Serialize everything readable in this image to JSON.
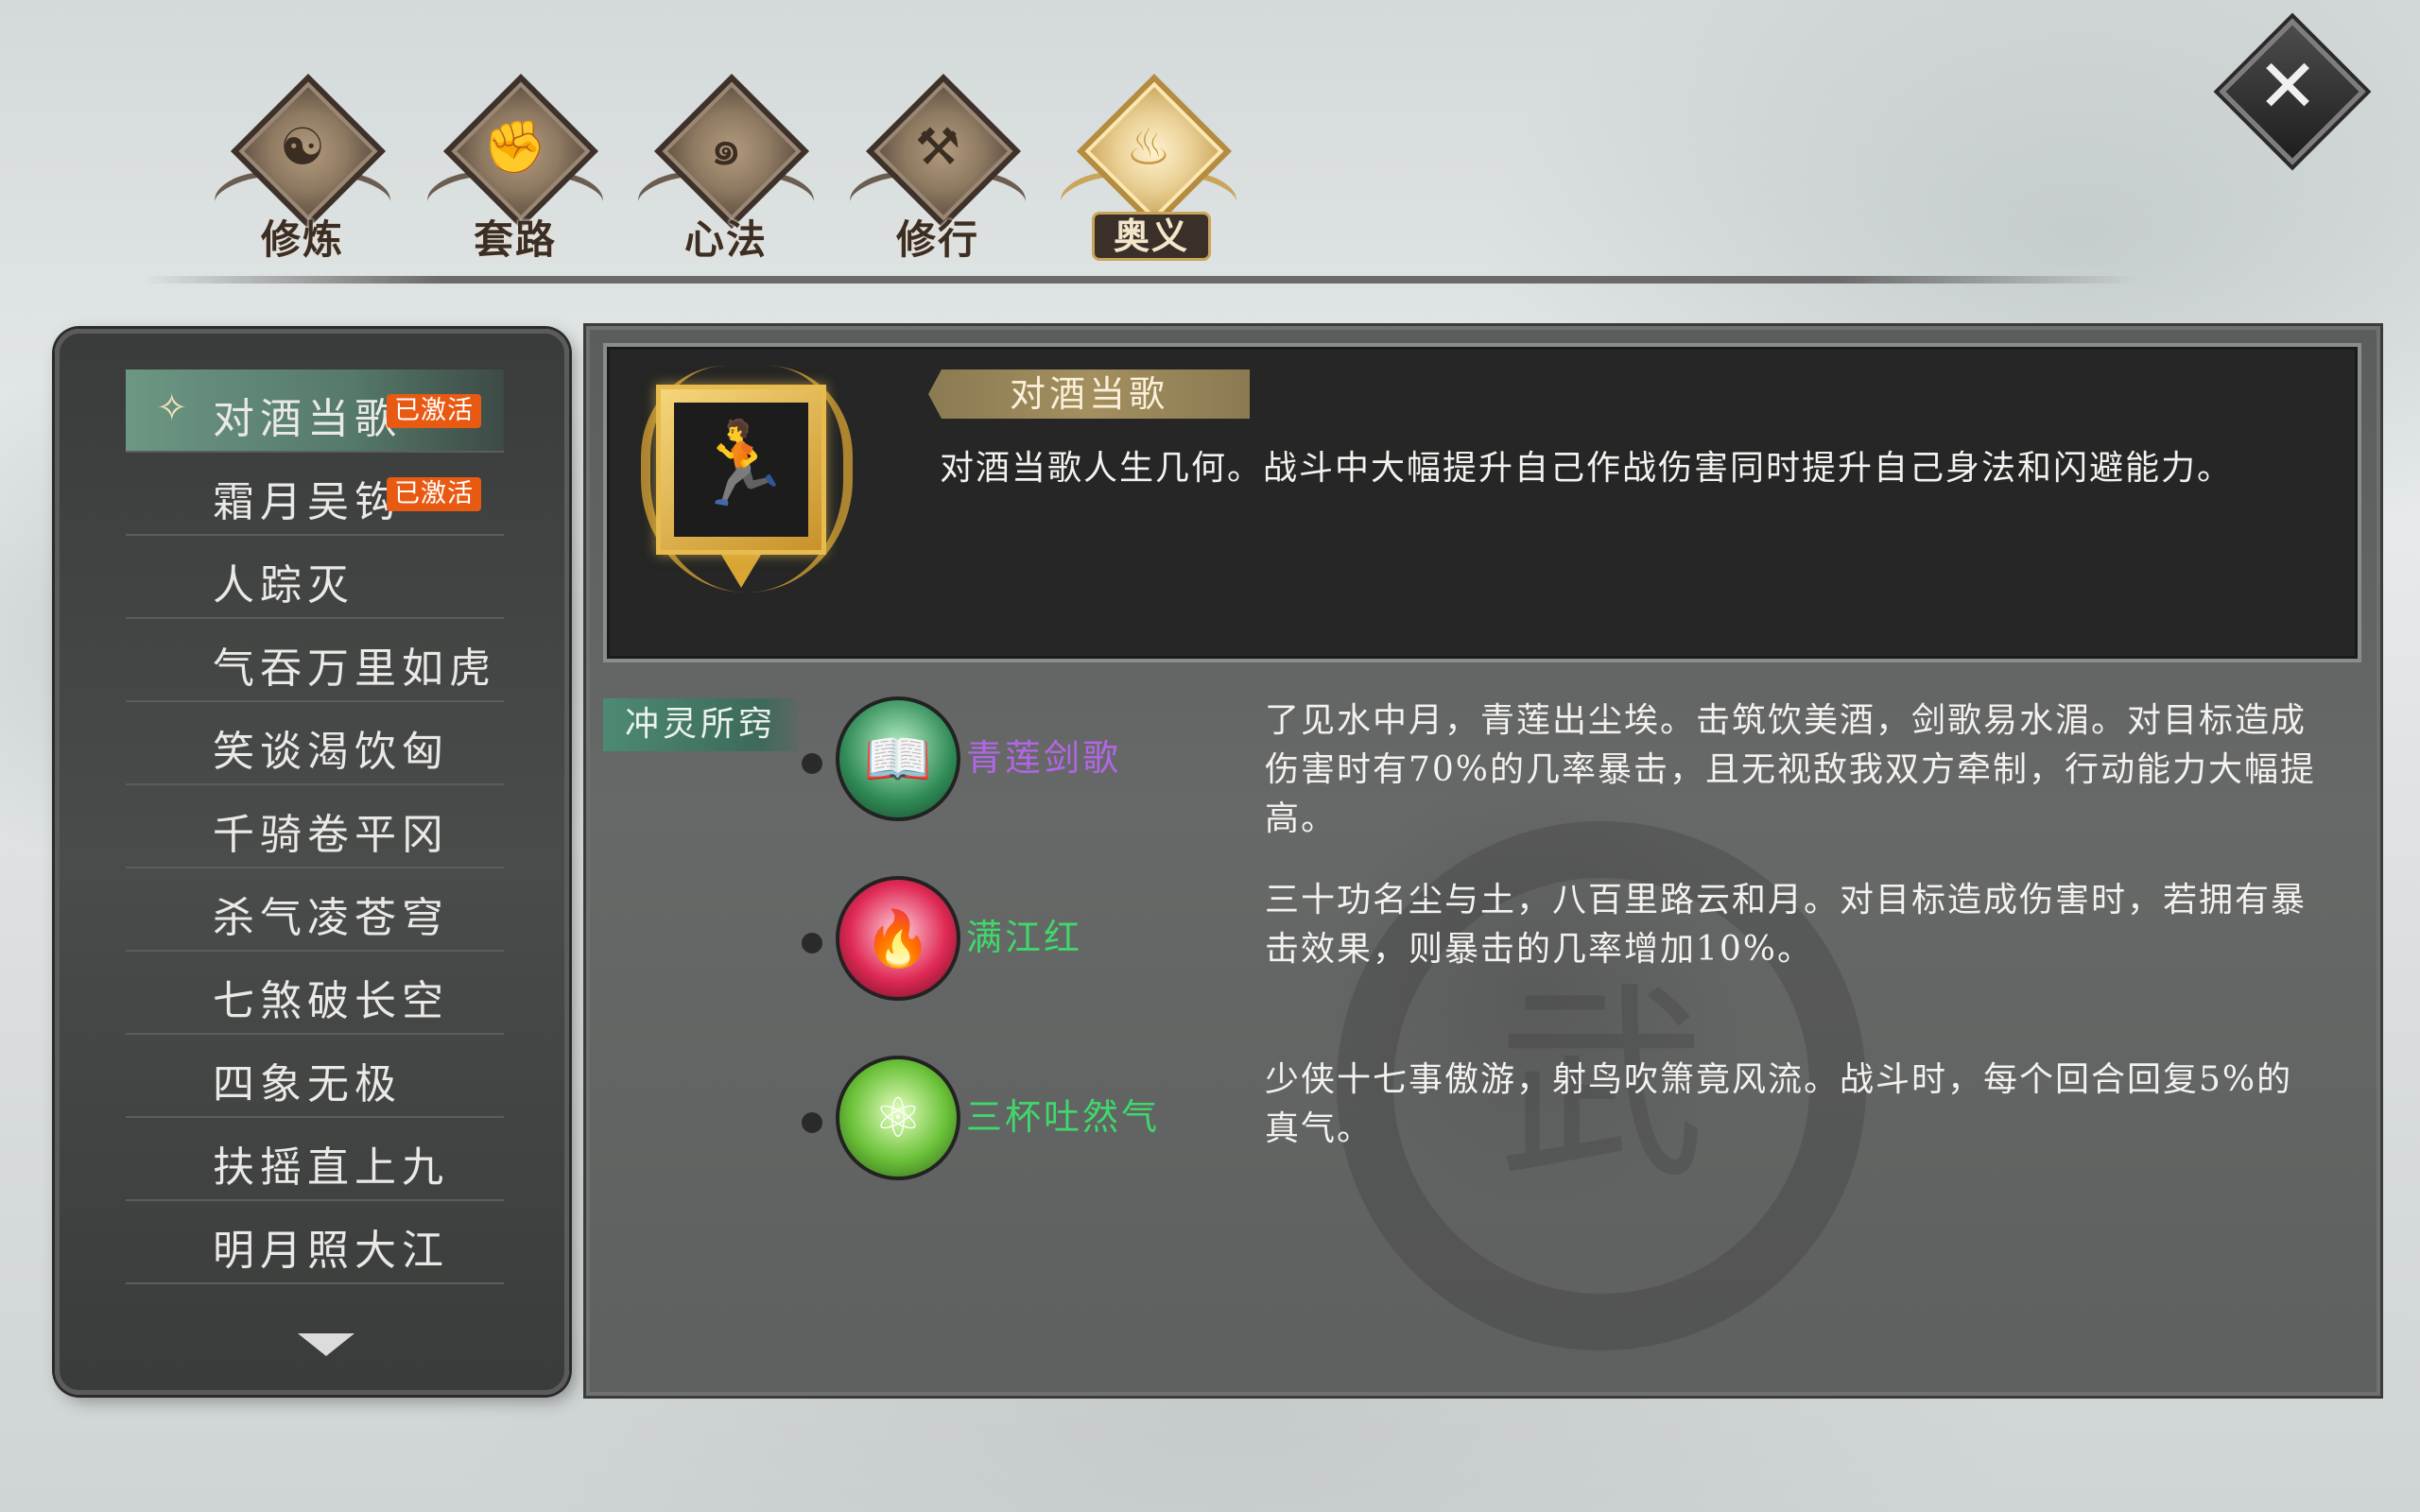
{
  "tabs": [
    {
      "label": "修炼",
      "icon": "yin-yang-icon",
      "glyph": "☯"
    },
    {
      "label": "套路",
      "icon": "fist-icon",
      "glyph": "✊"
    },
    {
      "label": "心法",
      "icon": "swirl-icon",
      "glyph": "๑"
    },
    {
      "label": "修行",
      "icon": "scroll-icon",
      "glyph": "⚒"
    },
    {
      "label": "奥义",
      "icon": "flame-icon",
      "glyph": "♨"
    }
  ],
  "active_tab": "奥义",
  "close": {
    "glyph": "✕"
  },
  "skill_list": [
    {
      "name": "对酒当歌",
      "badge": "已激活",
      "selected": true
    },
    {
      "name": "霜月吴钩",
      "badge": "已激活"
    },
    {
      "name": "人踪灭"
    },
    {
      "name": "气吞万里如虎"
    },
    {
      "name": "笑谈渴饮匈"
    },
    {
      "name": "千骑卷平冈"
    },
    {
      "name": "杀气凌苍穹"
    },
    {
      "name": "七煞破长空"
    },
    {
      "name": "四象无极"
    },
    {
      "name": "扶摇直上九"
    },
    {
      "name": "明月照大江"
    }
  ],
  "selected_arrow": "✧",
  "detail": {
    "title": "对酒当歌",
    "icon_glyph": "🏃",
    "description": "对酒当歌人生几何。战斗中大幅提升自己作战伤害同时提升自己身法和闪避能力。",
    "emblem_glyph": "武"
  },
  "section_tag": "冲灵所窍",
  "sub_skills": [
    {
      "name": "青莲剑歌",
      "icon": "lotus-book-icon",
      "glyph": "📖",
      "name_color": "#b266e6",
      "description": "了见水中月，青莲出尘埃。击筑饮美酒，剑歌易水湄。对目标造成伤害时有70%的几率暴击，且无视敌我双方牵制，行动能力大幅提高。"
    },
    {
      "name": "满江红",
      "icon": "red-flame-icon",
      "glyph": "🔥",
      "name_color": "#3fd86b",
      "description": "三十功名尘与土，八百里路云和月。对目标造成伤害时，若拥有暴击效果，则暴击的几率增加10%。"
    },
    {
      "name": "三杯吐然气",
      "icon": "green-rune-icon",
      "glyph": "⚛",
      "name_color": "#3fd86b",
      "description": "少侠十七事傲游，射鸟吹箫竟风流。战斗时，每个回合回复5%的真气。"
    }
  ],
  "colors": {
    "panel_dark": "#252625",
    "selected_row": "#6d9683",
    "badge": "#e85a12",
    "gold": "#c9a45a",
    "section_tag": "#4d8a73"
  }
}
